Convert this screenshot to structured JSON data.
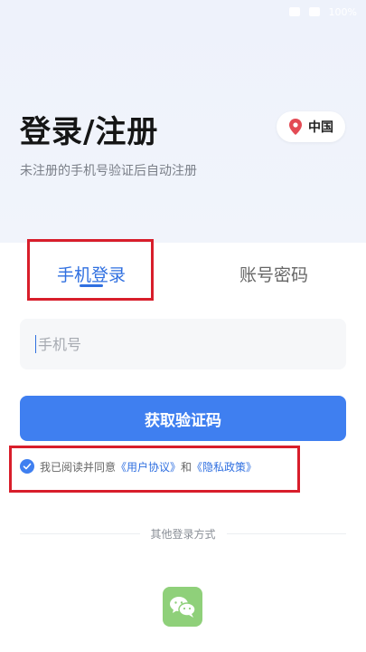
{
  "status_bar": {
    "battery_text": "100%"
  },
  "header": {
    "title": "登录/注册",
    "subtitle": "未注册的手机号验证后自动注册",
    "region": {
      "icon": "location-pin-icon",
      "label": "中国"
    }
  },
  "tabs": [
    {
      "label": "手机登录",
      "active": true
    },
    {
      "label": "账号密码",
      "active": false
    }
  ],
  "phone_field": {
    "placeholder": "手机号",
    "value": ""
  },
  "submit_label": "获取验证码",
  "agreement": {
    "checked": true,
    "prefix": "我已阅读并同意",
    "terms": "《用户协议》",
    "conjunction": "和",
    "privacy": "《隐私政策》"
  },
  "other_login": {
    "label": "其他登录方式",
    "options": [
      {
        "icon": "wechat-icon"
      }
    ]
  },
  "colors": {
    "accent": "#3f7ff0",
    "accent_text": "#2f6fe0",
    "highlight": "#d81e2b",
    "wechat": "#8fd07a"
  }
}
